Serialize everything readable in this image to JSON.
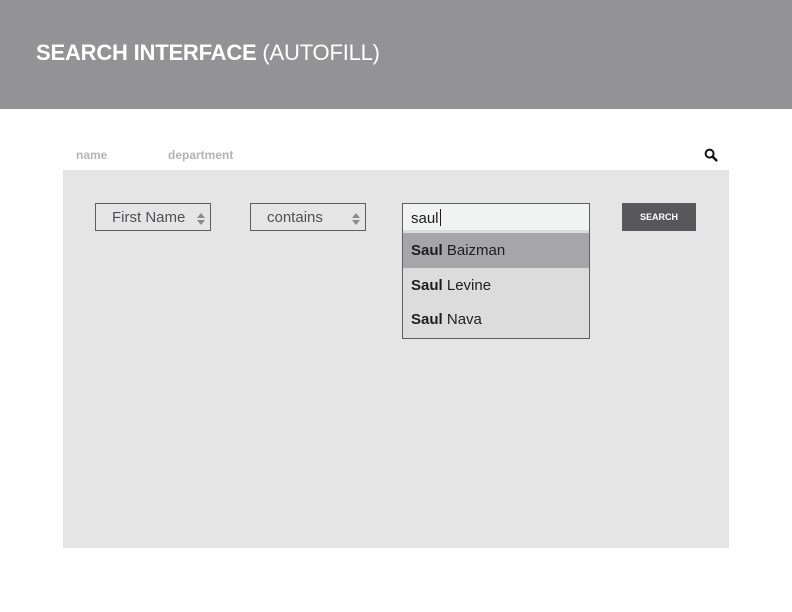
{
  "header": {
    "title_bold": "SEARCH INTERFACE",
    "title_light": "(AUTOFILL)",
    "background_color": "#939396"
  },
  "tabs": [
    {
      "label": "name"
    },
    {
      "label": "department"
    }
  ],
  "search_icon": "search-icon",
  "filters": {
    "field_select": {
      "selected": "First Name"
    },
    "operator_select": {
      "selected": "contains"
    },
    "query_input": {
      "value": "saul"
    }
  },
  "search_button": {
    "label": "SEARCH"
  },
  "suggestions": [
    {
      "match": "Saul",
      "rest": "Baizman",
      "highlighted": true
    },
    {
      "match": "Saul",
      "rest": "Levine",
      "highlighted": false
    },
    {
      "match": "Saul",
      "rest": "Nava",
      "highlighted": false
    }
  ],
  "colors": {
    "panel": "#e5e5e6",
    "button": "#58585a",
    "highlight": "#a6a6a8",
    "tab_text": "#b4b4b6"
  }
}
